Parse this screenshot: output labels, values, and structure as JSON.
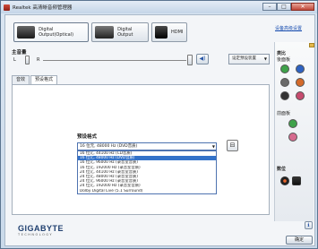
{
  "window": {
    "title": "Realtek 高清晰音频管理器",
    "icon": "speaker-app-icon",
    "controls": {
      "minimize": "–",
      "maximize": "□",
      "close": "✕"
    }
  },
  "device_tabs": [
    {
      "label": "Digital Output(Optical)",
      "icon": "optical-device-icon"
    },
    {
      "label": "Digital Output",
      "icon": "digital-device-icon"
    },
    {
      "label": "HDMI",
      "icon": "hdmi-device-icon"
    }
  ],
  "advanced_link": "设备高级设置",
  "volume": {
    "title": "主音量",
    "left": "L",
    "right": "R",
    "mute_icon": "speaker-icon"
  },
  "set_default": {
    "label": "设定预设装置",
    "arrow": "▼"
  },
  "sub_tabs": [
    "音效",
    "预设格式"
  ],
  "default_format": {
    "title": "预设格式",
    "selected": "16 位元, 48000 Hz (DVD音质)",
    "options": [
      "16 位元, 44100 Hz (CD音质)",
      "16 位元, 48000 Hz (DVD音质)",
      "16 位元, 96000 Hz (录音室音质)",
      "16 位元, 192000 Hz (录音室音质)",
      "24 位元, 44100 Hz (录音室音质)",
      "24 位元, 48000 Hz (录音室音质)",
      "24 位元, 96000 Hz (录音室音质)",
      "24 位元, 192000 Hz (录音室音质)",
      "Dolby Digital Live (5.1 Surround)"
    ],
    "highlighted_index": 1
  },
  "right_panel": {
    "analog_label": "类比",
    "rear_label": "後面板",
    "front_label": "前面板",
    "digital_label": "数位"
  },
  "colors": {
    "rear_jacks": [
      "#3fa24a",
      "#2e62c2",
      "#6a6a6a",
      "#d46a2a",
      "#333333",
      "#c64b6e"
    ],
    "front_jacks": [
      "#3fa24a",
      "#d66a8e"
    ],
    "selection": "#3372c9"
  },
  "footer": {
    "brand": "GIGABYTE",
    "brand_sub": "TECHNOLOGY",
    "ok": "确定",
    "info_icon": "info-icon"
  }
}
